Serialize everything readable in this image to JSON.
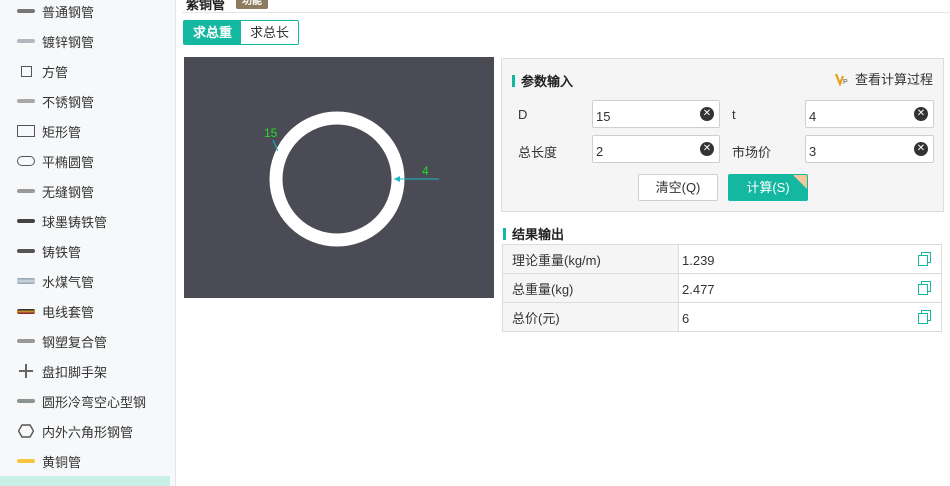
{
  "sidebar": {
    "items": [
      {
        "label": "普通钢管",
        "icon": "gray-bar-icon",
        "color": "#777777"
      },
      {
        "label": "镀锌钢管",
        "icon": "light-gray-bar-icon",
        "color": "#b3b8c0"
      },
      {
        "label": "方管",
        "icon": "square-icon",
        "color": "#555555"
      },
      {
        "label": "不锈钢管",
        "icon": "silver-bar-icon",
        "color": "#a8a8a8"
      },
      {
        "label": "矩形管",
        "icon": "rectangle-icon",
        "color": "#555555"
      },
      {
        "label": "平椭圆管",
        "icon": "oval-icon",
        "color": "#555555"
      },
      {
        "label": "无缝钢管",
        "icon": "gray-bar-icon",
        "color": "#999999"
      },
      {
        "label": "球墨铸铁管",
        "icon": "dark-bar-icon",
        "color": "#444444"
      },
      {
        "label": "铸铁管",
        "icon": "dark-bar-icon",
        "color": "#555555"
      },
      {
        "label": "水煤气管",
        "icon": "pipe-icon",
        "color": "#8aa0b0"
      },
      {
        "label": "电线套管",
        "icon": "striped-bar-icon",
        "color": "#8a6a3a"
      },
      {
        "label": "钢塑复合管",
        "icon": "gray-bar-icon",
        "color": "#999999"
      },
      {
        "label": "盘扣脚手架",
        "icon": "cross-icon",
        "color": "#666666"
      },
      {
        "label": "圆形冷弯空心型钢",
        "icon": "gray-green-bar-icon",
        "color": "#8a9590"
      },
      {
        "label": "内外六角形钢管",
        "icon": "hexagon-icon",
        "color": "#555555"
      },
      {
        "label": "黄铜管",
        "icon": "yellow-bar-icon",
        "color": "#f5c542"
      }
    ]
  },
  "header": {
    "title": "紫铜管",
    "badge": "功能"
  },
  "mode_tabs": [
    {
      "label": "求总重",
      "active": true
    },
    {
      "label": "求总长",
      "active": false
    }
  ],
  "preview": {
    "outer_label": "15",
    "thickness_label": "4"
  },
  "params": {
    "title": "参数输入",
    "view_process": "查看计算过程",
    "fields": {
      "D": {
        "label": "D",
        "value": "15"
      },
      "t": {
        "label": "t",
        "value": "4"
      },
      "length": {
        "label": "总长度",
        "value": "2"
      },
      "price": {
        "label": "市场价",
        "value": "3"
      }
    },
    "clear_label": "清空(Q)",
    "calc_label": "计算(S)"
  },
  "results": {
    "title": "结果输出",
    "rows": [
      {
        "label": "理论重量(kg/m)",
        "value": "1.239"
      },
      {
        "label": "总重量(kg)",
        "value": "2.477"
      },
      {
        "label": "总价(元)",
        "value": "6"
      }
    ]
  },
  "colors": {
    "accent": "#14b8a0",
    "preview_bg": "#4a4b55",
    "dimension": "#22dd22",
    "dimension_line": "#1ab8c8"
  }
}
